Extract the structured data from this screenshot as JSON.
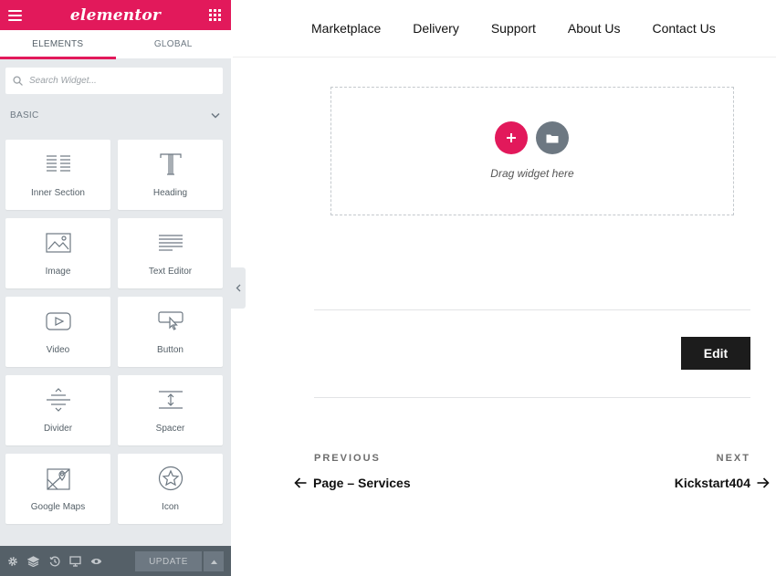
{
  "app": {
    "logo_text": "elementor",
    "brand_color": "#e2195b",
    "panel_color": "#e6e9ec"
  },
  "panel": {
    "tabs": [
      {
        "label": "ELEMENTS",
        "active": true
      },
      {
        "label": "GLOBAL",
        "active": false
      }
    ],
    "search": {
      "placeholder": "Search Widget...",
      "value": ""
    },
    "category": {
      "label": "BASIC",
      "expanded": true
    },
    "widgets": [
      {
        "label": "Inner Section",
        "icon": "inner-section-icon"
      },
      {
        "label": "Heading",
        "icon": "heading-icon"
      },
      {
        "label": "Image",
        "icon": "image-icon"
      },
      {
        "label": "Text Editor",
        "icon": "text-editor-icon"
      },
      {
        "label": "Video",
        "icon": "video-icon"
      },
      {
        "label": "Button",
        "icon": "button-icon"
      },
      {
        "label": "Divider",
        "icon": "divider-icon"
      },
      {
        "label": "Spacer",
        "icon": "spacer-icon"
      },
      {
        "label": "Google Maps",
        "icon": "google-maps-icon"
      },
      {
        "label": "Icon",
        "icon": "star-icon"
      }
    ],
    "footer": {
      "icons": [
        "settings-icon",
        "navigator-icon",
        "history-icon",
        "responsive-icon",
        "preview-icon"
      ],
      "update_label": "UPDATE"
    }
  },
  "preview": {
    "nav": [
      "Marketplace",
      "Delivery",
      "Support",
      "About Us",
      "Contact Us"
    ],
    "dropzone": {
      "text": "Drag widget here"
    },
    "edit_button": "Edit",
    "post_nav": {
      "previous_label": "PREVIOUS",
      "previous_title": "Page – Services",
      "next_label": "NEXT",
      "next_title": "Kickstart404"
    }
  }
}
